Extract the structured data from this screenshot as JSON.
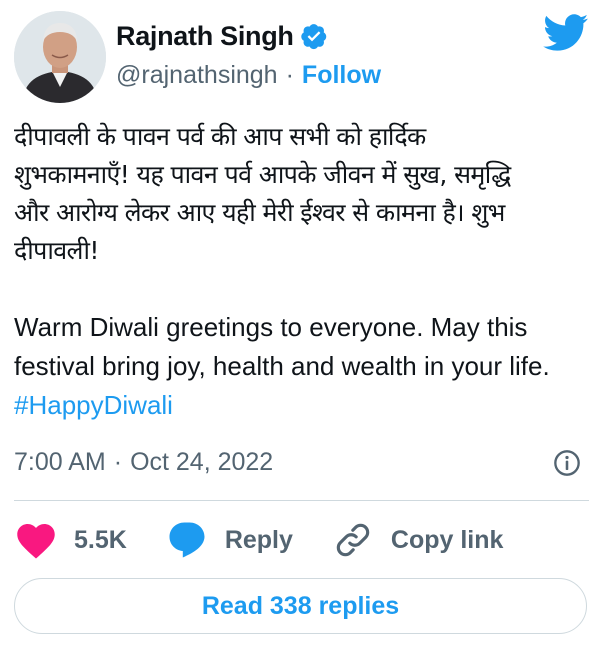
{
  "author": {
    "name": "Rajnath Singh",
    "handle": "@rajnathsingh",
    "separator": "·",
    "follow_label": "Follow"
  },
  "tweet": {
    "hindi_text": "दीपावली के पावन पर्व की आप सभी को हार्दिक\nशुभकामनाएँ! यह पावन पर्व आपके जीवन में सुख, समृद्धि\nऔर आरोग्य लेकर आए यही मेरी ईश्वर से कामना है। शुभ\nदीपावली!",
    "english_text": "Warm Diwali greetings to everyone. May this\nfestival bring joy, health and wealth in your life.",
    "hashtag": "#HappyDiwali"
  },
  "meta": {
    "time": "7:00 AM",
    "separator": "·",
    "date": "Oct 24, 2022"
  },
  "actions": {
    "like_count": "5.5K",
    "reply_label": "Reply",
    "copy_link_label": "Copy link"
  },
  "read_replies_label": "Read 338 replies",
  "colors": {
    "accent": "#1d9bf0",
    "like": "#f91880",
    "text_primary": "#0f1419",
    "text_secondary": "#536471",
    "border": "#cfd9de"
  },
  "icons": {
    "verified": "verified-badge-icon",
    "brand": "twitter-bird-icon",
    "info": "info-icon",
    "like": "heart-icon",
    "reply": "speech-bubble-icon",
    "copy_link": "link-icon"
  }
}
